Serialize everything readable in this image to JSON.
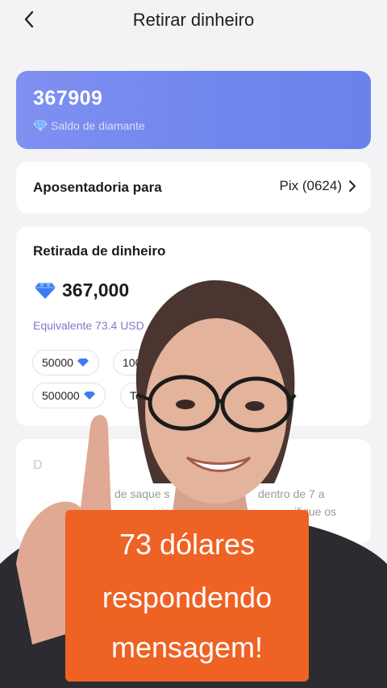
{
  "header": {
    "title": "Retirar dinheiro",
    "back_icon": "chevron-left-icon"
  },
  "balance": {
    "value": "367909",
    "label": "Saldo de diamante",
    "icon": "diamond-icon"
  },
  "method": {
    "label": "Aposentadoria para",
    "value": "Pix (0624)",
    "arrow_icon": "chevron-right-icon"
  },
  "withdrawal": {
    "title": "Retirada de dinheiro",
    "amount": "367,000",
    "equivalent": "Equivalente 73.4 USD",
    "options": [
      {
        "label": "50000"
      },
      {
        "label": "100"
      },
      {
        "label": "500000"
      },
      {
        "label": "To"
      }
    ]
  },
  "description": {
    "title": "D",
    "line1_start": "de saque s",
    "line1_end": "dentro de 7 a",
    "line2_start": "iciado",
    "line2_end": "ifique os"
  },
  "caption": {
    "line1": "73 dólares",
    "line2": "respondendo",
    "line3": "mensagem!"
  },
  "colors": {
    "balance_card": "#6f86ee",
    "caption_bg": "#ee6224",
    "equivalent_text": "#7f78c8",
    "diamond": "#3d7bf0"
  }
}
